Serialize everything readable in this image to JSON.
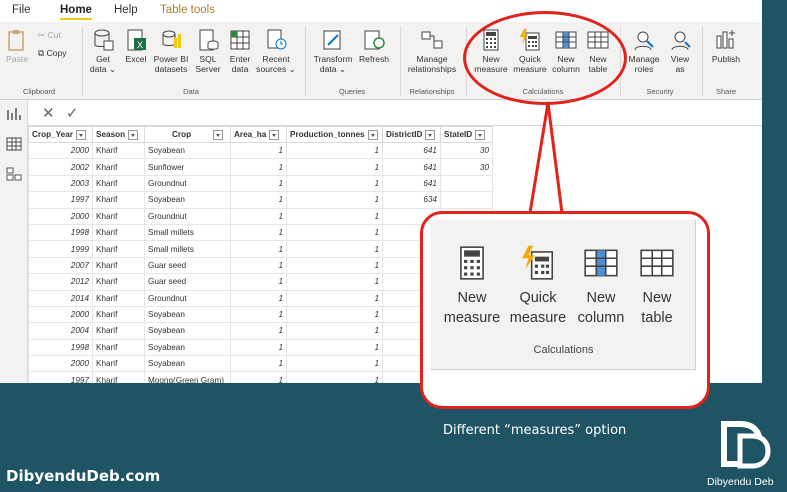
{
  "tabs": [
    "File",
    "Home",
    "Help",
    "Table tools"
  ],
  "ribbon": {
    "clipboard": {
      "paste": "Paste",
      "cut": "Cut",
      "copy": "Copy",
      "label": "Clipboard"
    },
    "data": {
      "items": [
        {
          "line1": "Get",
          "line2": "data ⌄"
        },
        {
          "line1": "Excel",
          "line2": ""
        },
        {
          "line1": "Power BI",
          "line2": "datasets"
        },
        {
          "line1": "SQL",
          "line2": "Server"
        },
        {
          "line1": "Enter",
          "line2": "data"
        },
        {
          "line1": "Recent",
          "line2": "sources ⌄"
        }
      ],
      "label": "Data"
    },
    "queries": {
      "transform1": "Transform",
      "transform2": "data ⌄",
      "refresh": "Refresh",
      "label": "Queries"
    },
    "relationships": {
      "line1": "Manage",
      "line2": "relationships",
      "label": "Relationships"
    },
    "calculations": {
      "items": [
        {
          "line1": "New",
          "line2": "measure"
        },
        {
          "line1": "Quick",
          "line2": "measure"
        },
        {
          "line1": "New",
          "line2": "column"
        },
        {
          "line1": "New",
          "line2": "table"
        }
      ],
      "label": "Calculations"
    },
    "security": {
      "manage1": "Manage",
      "manage2": "roles",
      "view1": "View",
      "view2": "as",
      "label": "Security"
    },
    "share": {
      "publish": "Publish",
      "label": "Share"
    }
  },
  "formula": {
    "cancel": "✕",
    "commit": "✓"
  },
  "table": {
    "headers": [
      "Crop_Year",
      "Season",
      "Crop",
      "Area_ha",
      "Production_tonnes",
      "DistrictID",
      "StateID"
    ],
    "rows": [
      [
        "2000",
        "Kharif",
        "Soyabean",
        "1",
        "1",
        "641",
        "30"
      ],
      [
        "2002",
        "Kharif",
        "Sunflower",
        "1",
        "1",
        "641",
        "30"
      ],
      [
        "2003",
        "Kharif",
        "Groundnut",
        "1",
        "1",
        "641",
        ""
      ],
      [
        "1997",
        "Kharif",
        "Soyabean",
        "1",
        "1",
        "634",
        ""
      ],
      [
        "2000",
        "Kharif",
        "Groundnut",
        "1",
        "1",
        "",
        ""
      ],
      [
        "1998",
        "Kharif",
        "Small millets",
        "1",
        "1",
        "",
        ""
      ],
      [
        "1999",
        "Kharif",
        "Small millets",
        "1",
        "1",
        "",
        ""
      ],
      [
        "2007",
        "Kharif",
        "Guar seed",
        "1",
        "1",
        "",
        ""
      ],
      [
        "2012",
        "Kharif",
        "Guar seed",
        "1",
        "1",
        "",
        ""
      ],
      [
        "2014",
        "Kharif",
        "Groundnut",
        "1",
        "1",
        "",
        ""
      ],
      [
        "2000",
        "Kharif",
        "Soyabean",
        "1",
        "1",
        "",
        ""
      ],
      [
        "2004",
        "Kharif",
        "Soyabean",
        "1",
        "1",
        "",
        ""
      ],
      [
        "1998",
        "Kharif",
        "Soyabean",
        "1",
        "1",
        "",
        ""
      ],
      [
        "2000",
        "Kharif",
        "Soyabean",
        "1",
        "1",
        "",
        ""
      ],
      [
        "1997",
        "Kharif",
        "Moong(Green Gram)",
        "1",
        "1",
        "",
        ""
      ]
    ]
  },
  "callout": {
    "items": [
      {
        "line1": "New",
        "line2": "measure"
      },
      {
        "line1": "Quick",
        "line2": "measure"
      },
      {
        "line1": "New",
        "line2": "column"
      },
      {
        "line1": "New",
        "line2": "table"
      }
    ],
    "label": "Calculations"
  },
  "caption": "Different “measures” option",
  "site": "DibyenduDeb.com",
  "logo_text": "Dibyendu Deb",
  "colors": {
    "accent": "#e0231c",
    "background": "#1f5464",
    "ribbon": "#f3f2f1",
    "tab_underline": "#f2c811"
  }
}
